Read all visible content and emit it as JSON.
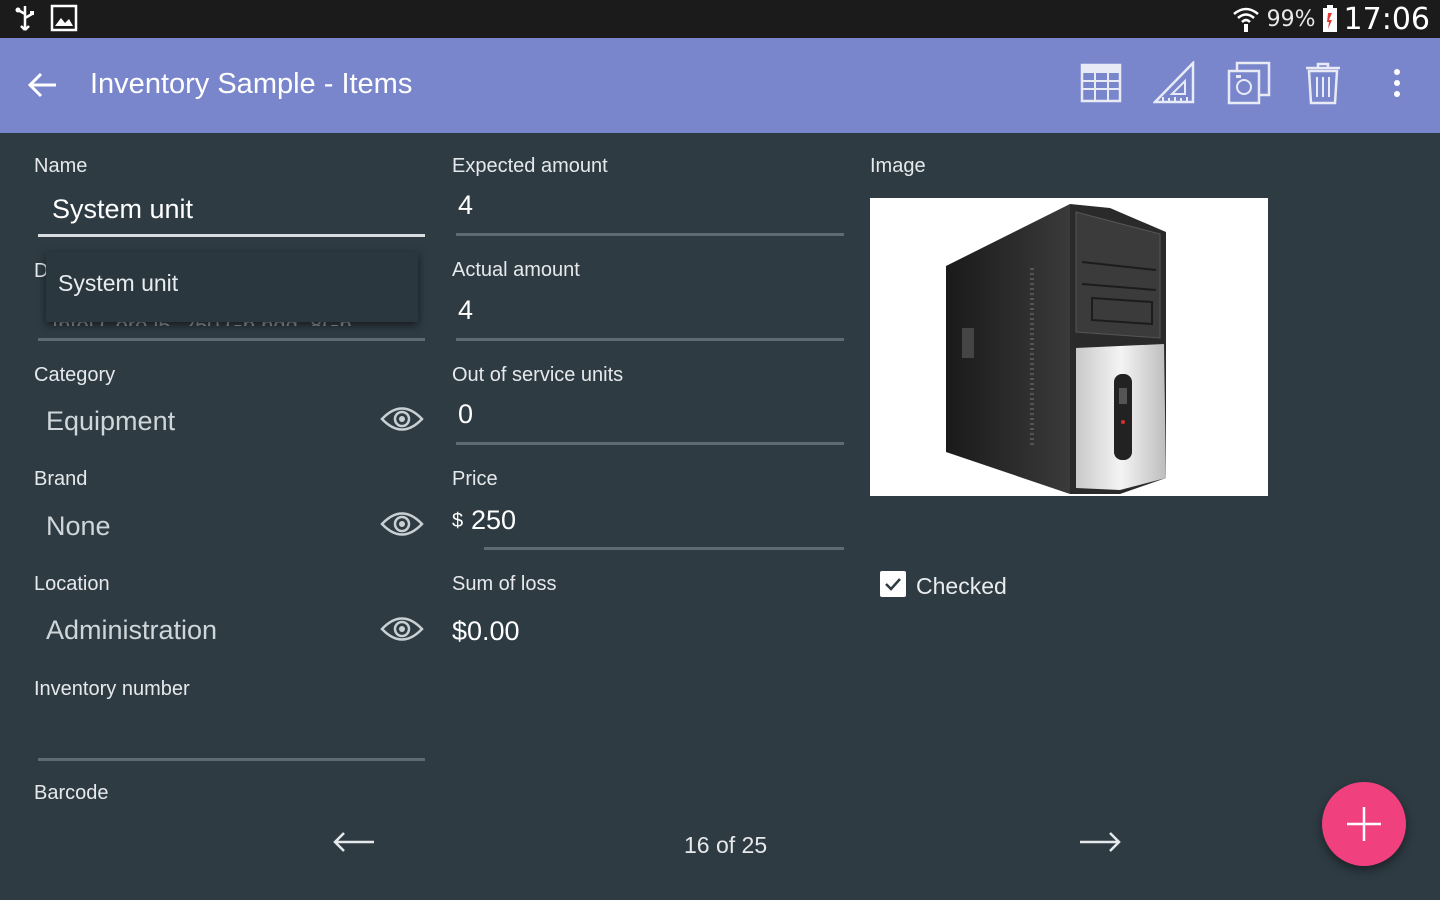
{
  "status_bar": {
    "battery_text": "99%",
    "time": "17:06",
    "icons": [
      "usb-icon",
      "image-notification-icon",
      "wifi-icon",
      "battery-icon"
    ]
  },
  "app_bar": {
    "title": "Inventory Sample - Items",
    "background_color": "#7986cb",
    "actions": [
      "table-icon",
      "ruler-icon",
      "copy-image-icon",
      "trash-icon",
      "more-vert-icon"
    ]
  },
  "form": {
    "name": {
      "label": "Name",
      "value": "System unit"
    },
    "description": {
      "label_fragment": "D",
      "suggestion": "System unit"
    },
    "category": {
      "label": "Category",
      "value": "Equipment"
    },
    "brand": {
      "label": "Brand",
      "value": "None"
    },
    "location": {
      "label": "Location",
      "value": "Administration"
    },
    "inventory_number": {
      "label": "Inventory number",
      "value": ""
    },
    "barcode": {
      "label": "Barcode"
    },
    "expected_amount": {
      "label": "Expected amount",
      "value": "4"
    },
    "actual_amount": {
      "label": "Actual amount",
      "value": "4"
    },
    "out_of_service": {
      "label": "Out of service units",
      "value": "0"
    },
    "price": {
      "label": "Price",
      "currency": "$",
      "value": "250"
    },
    "sum_of_loss": {
      "label": "Sum of loss",
      "value": "$0.00"
    },
    "image": {
      "label": "Image",
      "description": "computer-tower-icon"
    },
    "checked": {
      "label": "Checked",
      "value": true
    }
  },
  "pager": {
    "text": "16 of 25"
  },
  "colors": {
    "background": "#2e3b43",
    "fab": "#f0407e"
  }
}
